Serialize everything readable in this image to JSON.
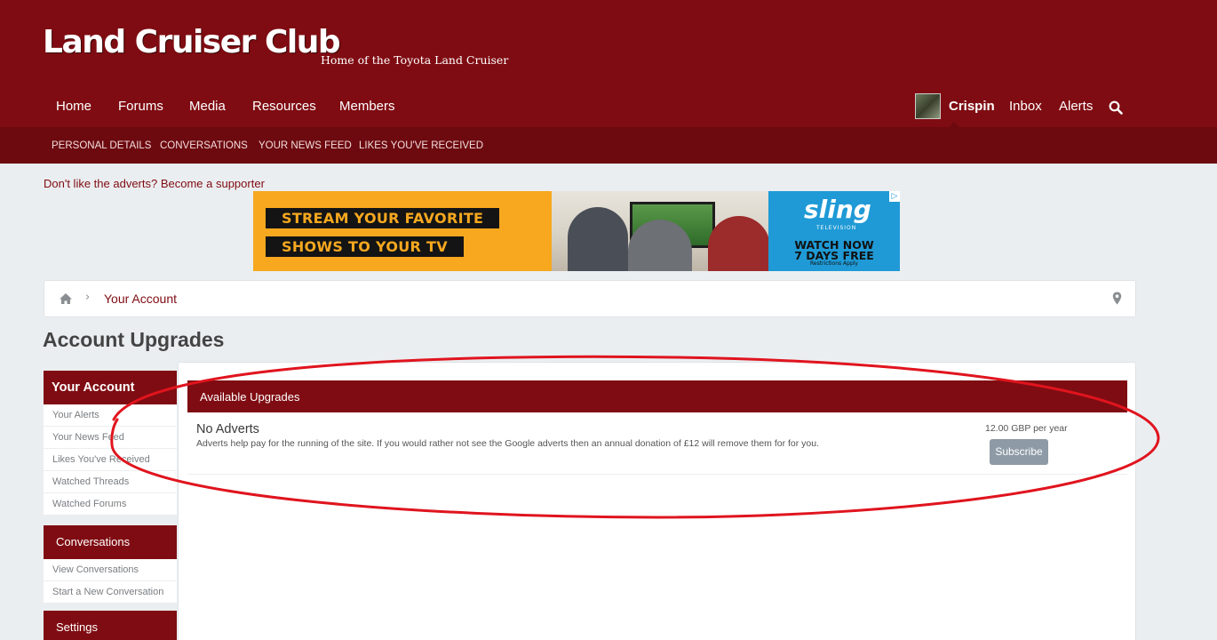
{
  "site": {
    "title": "Land Cruiser Club",
    "tagline": "Home of the Toyota Land Cruiser"
  },
  "nav": {
    "items": [
      "Home",
      "Forums",
      "Media",
      "Resources",
      "Members"
    ],
    "user": "Crispin",
    "inbox": "Inbox",
    "alerts": "Alerts"
  },
  "subnav": {
    "items": [
      "PERSONAL DETAILS",
      "CONVERSATIONS",
      "YOUR NEWS FEED",
      "LIKES YOU'VE RECEIVED"
    ]
  },
  "notice": "Don't like the adverts? Become a supporter",
  "ad": {
    "line1": "STREAM YOUR FAVORITE",
    "line2": "SHOWS TO YOUR TV",
    "brand": "sling",
    "brand_sub": "TELEVISION",
    "cta1": "WATCH NOW",
    "cta2": "7 DAYS FREE",
    "fine_print": "Restrictions Apply"
  },
  "breadcrumb": {
    "link": "Your Account"
  },
  "page_title": "Account Upgrades",
  "sidebar": {
    "account": {
      "title": "Your Account",
      "items": [
        "Your Alerts",
        "Your News Feed",
        "Likes You've Received",
        "Watched Threads",
        "Watched Forums"
      ]
    },
    "conversations": {
      "title": "Conversations",
      "items": [
        "View Conversations",
        "Start a New Conversation"
      ]
    },
    "settings": {
      "title": "Settings"
    }
  },
  "upgrades": {
    "header": "Available Upgrades",
    "items": [
      {
        "title": "No Adverts",
        "description": "Adverts help pay for the running of the site. If you would rather not see the Google adverts then an annual donation of £12 will remove them for for you.",
        "cost": "12.00 GBP per year",
        "button": "Subscribe"
      }
    ]
  },
  "colors": {
    "brand": "#7f0c12",
    "subnav": "#6c0a0f",
    "page_bg": "#ebeef1",
    "annotation": "#e0141e"
  }
}
